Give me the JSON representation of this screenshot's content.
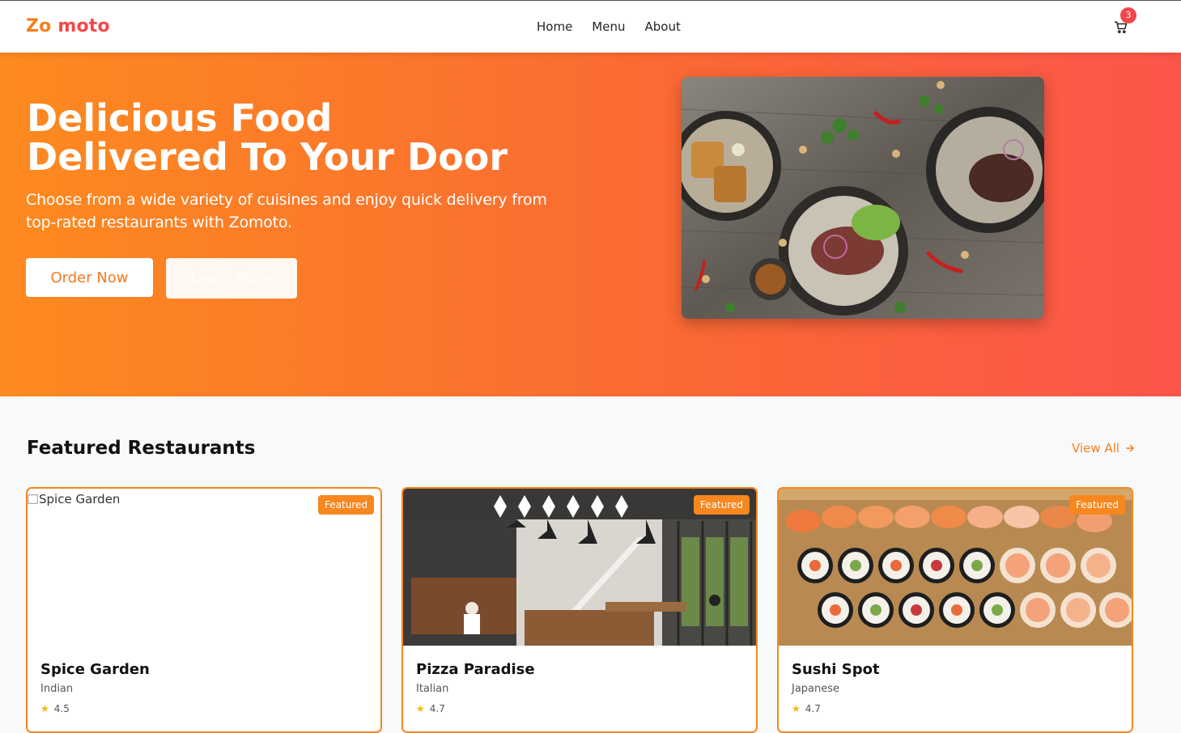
{
  "nav": {
    "logo_part1": "Zo",
    "logo_part2": "moto",
    "links": [
      "Home",
      "Menu",
      "About"
    ],
    "cart_count": "3",
    "cart_icon": "cart-icon"
  },
  "hero": {
    "title_line1": "Delicious Food",
    "title_line2": "Delivered To Your Door",
    "subtitle": "Choose from a wide variety of cuisines and enjoy quick delivery from top-rated restaurants with Zomoto.",
    "order_button": "Order Now",
    "learn_button": "Learn More"
  },
  "featured": {
    "title": "Featured Restaurants",
    "view_all": "View All",
    "badge": "Featured",
    "restaurants": [
      {
        "name": "Spice Garden",
        "cuisine": "Indian",
        "alt": "Spice Garden",
        "rating": "4.5"
      },
      {
        "name": "Pizza Paradise",
        "cuisine": "Italian",
        "rating": "4.7"
      },
      {
        "name": "Sushi Spot",
        "cuisine": "Japanese",
        "rating": "4.7"
      }
    ]
  },
  "colors": {
    "brand_orange": "#f77e1c",
    "brand_red": "#f2484b",
    "hero_gradient_start": "#fd8a1f",
    "hero_gradient_end": "#fb5549"
  }
}
